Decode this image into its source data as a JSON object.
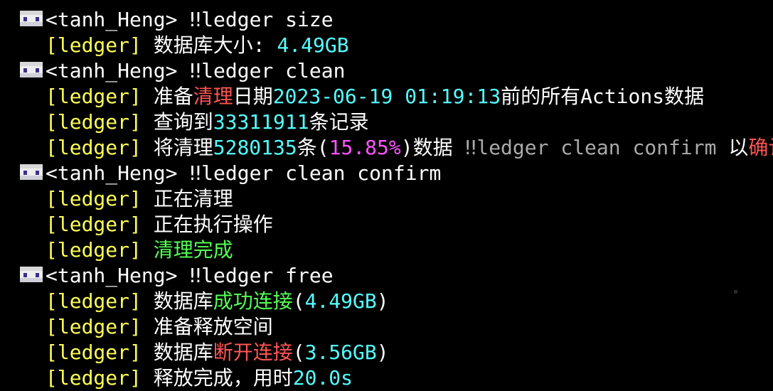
{
  "colors": {
    "white": "#ffffff",
    "yellow": "#ffff55",
    "aqua": "#55ffff",
    "red": "#ff5555",
    "green": "#55ff55",
    "pink": "#ff55ff",
    "gray": "#aaaaaa"
  },
  "lines": [
    {
      "kind": "player",
      "segments": [
        {
          "text": "<tanh_Heng> ‼ledger size",
          "color": "white"
        }
      ]
    },
    {
      "kind": "msg",
      "segments": [
        {
          "text": "[ledger] ",
          "color": "yellow"
        },
        {
          "text": "数据库大小: ",
          "color": "white"
        },
        {
          "text": "4.49GB",
          "color": "aqua"
        }
      ]
    },
    {
      "kind": "player",
      "segments": [
        {
          "text": "<tanh_Heng> ‼ledger clean",
          "color": "white"
        }
      ]
    },
    {
      "kind": "msg",
      "segments": [
        {
          "text": "[ledger] ",
          "color": "yellow"
        },
        {
          "text": "准备",
          "color": "white"
        },
        {
          "text": "清理",
          "color": "red"
        },
        {
          "text": "日期",
          "color": "white"
        },
        {
          "text": "2023-06-19 01:19:13",
          "color": "aqua"
        },
        {
          "text": "前的所有Actions数据",
          "color": "white"
        }
      ]
    },
    {
      "kind": "msg",
      "segments": [
        {
          "text": "[ledger] ",
          "color": "yellow"
        },
        {
          "text": "查询到",
          "color": "white"
        },
        {
          "text": "33311911",
          "color": "aqua"
        },
        {
          "text": "条记录",
          "color": "white"
        }
      ]
    },
    {
      "kind": "msg",
      "segments": [
        {
          "text": "[ledger] ",
          "color": "yellow"
        },
        {
          "text": "将清理",
          "color": "white"
        },
        {
          "text": "5280135",
          "color": "aqua"
        },
        {
          "text": "条(",
          "color": "white"
        },
        {
          "text": "15.85%",
          "color": "pink"
        },
        {
          "text": ")数据 ",
          "color": "white"
        },
        {
          "text": "‼ledger clean confirm ",
          "color": "gray"
        },
        {
          "text": "以",
          "color": "white"
        },
        {
          "text": "确认",
          "color": "red"
        }
      ]
    },
    {
      "kind": "player",
      "segments": [
        {
          "text": "<tanh_Heng> ‼ledger clean confirm",
          "color": "white"
        }
      ]
    },
    {
      "kind": "msg",
      "segments": [
        {
          "text": "[ledger] ",
          "color": "yellow"
        },
        {
          "text": "正在清理",
          "color": "white"
        }
      ]
    },
    {
      "kind": "msg",
      "segments": [
        {
          "text": "[ledger] ",
          "color": "yellow"
        },
        {
          "text": "正在执行操作",
          "color": "white"
        }
      ]
    },
    {
      "kind": "msg",
      "segments": [
        {
          "text": "[ledger] ",
          "color": "yellow"
        },
        {
          "text": "清理完成",
          "color": "green"
        }
      ]
    },
    {
      "kind": "player",
      "segments": [
        {
          "text": "<tanh_Heng> ‼ledger free",
          "color": "white"
        }
      ]
    },
    {
      "kind": "msg",
      "segments": [
        {
          "text": "[ledger] ",
          "color": "yellow"
        },
        {
          "text": "数据库",
          "color": "white"
        },
        {
          "text": "成功连接",
          "color": "green"
        },
        {
          "text": "(",
          "color": "white"
        },
        {
          "text": "4.49GB",
          "color": "aqua"
        },
        {
          "text": ")",
          "color": "white"
        }
      ]
    },
    {
      "kind": "msg",
      "segments": [
        {
          "text": "[ledger] ",
          "color": "yellow"
        },
        {
          "text": "准备释放空间",
          "color": "white"
        }
      ]
    },
    {
      "kind": "msg",
      "segments": [
        {
          "text": "[ledger] ",
          "color": "yellow"
        },
        {
          "text": "数据库",
          "color": "white"
        },
        {
          "text": "断开连接",
          "color": "red"
        },
        {
          "text": "(",
          "color": "white"
        },
        {
          "text": "3.56GB",
          "color": "aqua"
        },
        {
          "text": ")",
          "color": "white"
        }
      ]
    },
    {
      "kind": "msg",
      "segments": [
        {
          "text": "[ledger] ",
          "color": "yellow"
        },
        {
          "text": "释放完成，用时",
          "color": "white"
        },
        {
          "text": "20.0s",
          "color": "aqua"
        }
      ]
    }
  ]
}
